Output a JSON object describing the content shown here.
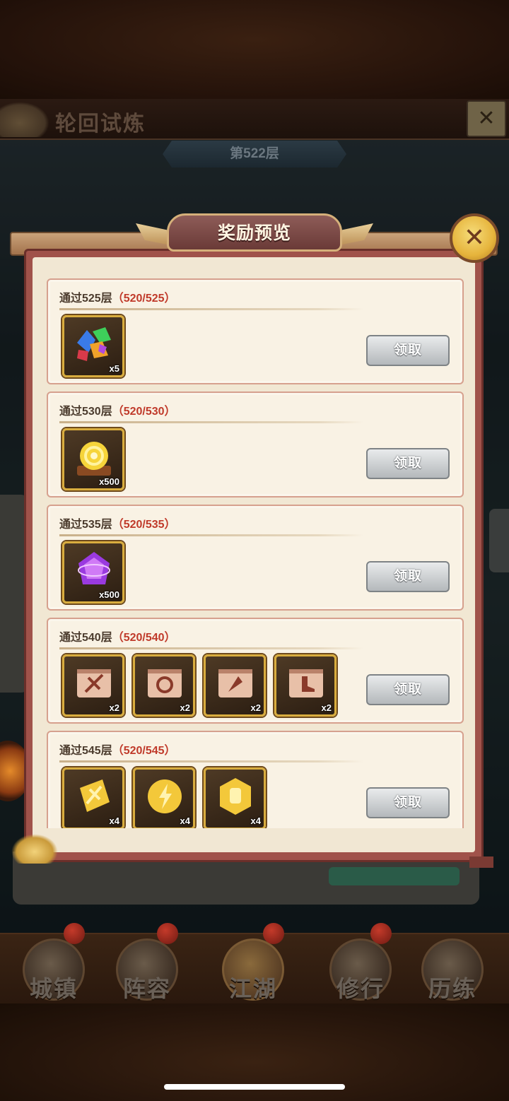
{
  "header": {
    "title": "轮回试炼",
    "floor": "第522层",
    "close_glyph": "✕"
  },
  "dialog": {
    "title": "奖励预览",
    "close_glyph": "✕",
    "claim_label": "领取",
    "rows": [
      {
        "cond": "通过525层",
        "progress": "（520/525）",
        "items": [
          {
            "icon": "gem-cluster-icon",
            "qty": "x5"
          }
        ]
      },
      {
        "cond": "通过530层",
        "progress": "（520/530）",
        "items": [
          {
            "icon": "gold-swirl-icon",
            "qty": "x500"
          }
        ]
      },
      {
        "cond": "通过535层",
        "progress": "（520/535）",
        "items": [
          {
            "icon": "purple-crystal-icon",
            "qty": "x500"
          }
        ]
      },
      {
        "cond": "通过540层",
        "progress": "（520/540）",
        "items": [
          {
            "icon": "scroll-sword-icon",
            "qty": "x2"
          },
          {
            "icon": "scroll-fist-icon",
            "qty": "x2"
          },
          {
            "icon": "scroll-knife-icon",
            "qty": "x2"
          },
          {
            "icon": "scroll-boot-icon",
            "qty": "x2"
          }
        ]
      },
      {
        "cond": "通过545层",
        "progress": "（520/545）",
        "items": [
          {
            "icon": "gold-token-sword-icon",
            "qty": "x4"
          },
          {
            "icon": "gold-token-bolt-icon",
            "qty": "x4"
          },
          {
            "icon": "gold-token-fist-icon",
            "qty": "x4"
          }
        ]
      }
    ]
  },
  "nav": [
    {
      "label": "城镇"
    },
    {
      "label": "阵容"
    },
    {
      "label": "江湖"
    },
    {
      "label": "修行"
    },
    {
      "label": "历练"
    }
  ],
  "colors": {
    "progress_red": "#c03a2a",
    "dialog_border": "#a0524a",
    "item_border": "#d9ad3f"
  }
}
